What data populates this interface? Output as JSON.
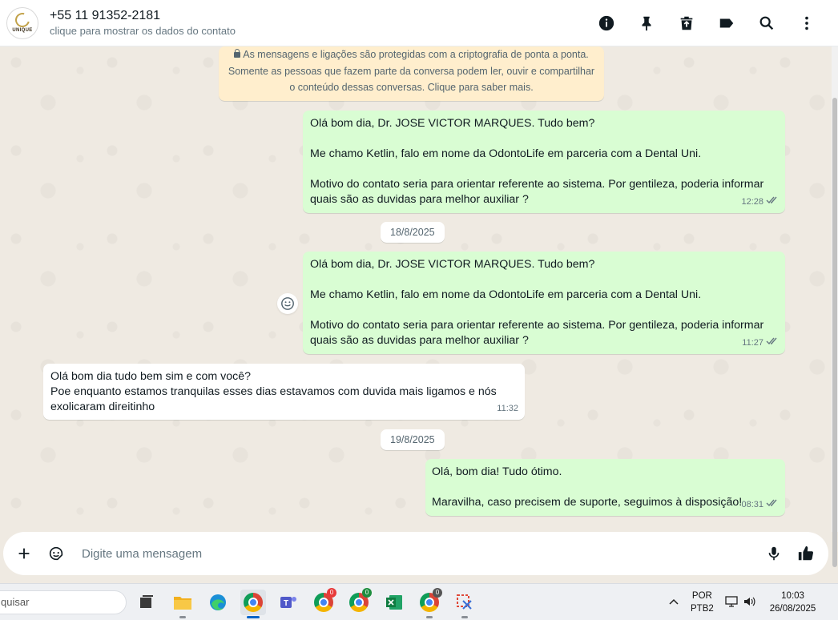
{
  "header": {
    "logo_text": "UNIQUE",
    "contact_name": "+55 11 91352-2181",
    "contact_subtitle": "clique para mostrar os dados do contato"
  },
  "encryption_notice": {
    "line1": "As mensagens e ligações são protegidas com a criptografia de ponta a ponta.",
    "line2": "Somente as pessoas que fazem parte da conversa podem ler, ouvir e compartilhar",
    "line3": "o conteúdo dessas conversas. Clique para saber mais."
  },
  "messages": [
    {
      "direction": "out",
      "lines": [
        "Olá bom dia, Dr. JOSE VICTOR MARQUES. Tudo bem?",
        "",
        "Me chamo Ketlin, falo em nome da OdontoLife em parceria com a Dental Uni.",
        "",
        "Motivo do contato seria para orientar referente ao sistema. Por gentileza, poderia informar",
        "quais são as duvidas para melhor auxiliar ?"
      ],
      "time": "12:28"
    },
    {
      "direction": "out",
      "lines": [
        "Olá bom dia, Dr. JOSE VICTOR MARQUES. Tudo bem?",
        "",
        "Me chamo Ketlin, falo em nome da OdontoLife em parceria com a Dental Uni.",
        "",
        "Motivo do contato seria para orientar referente ao sistema. Por gentileza, poderia informar",
        "quais são as duvidas para melhor auxiliar ?"
      ],
      "time": "11:27"
    },
    {
      "direction": "in",
      "lines": [
        "Olá bom dia tudo bem sim e com você?",
        "Poe enquanto estamos tranquilas esses dias estavamos com duvida mais ligamos e nós",
        "exolicaram direitinho"
      ],
      "time": "11:32"
    },
    {
      "direction": "out",
      "lines": [
        "Olá, bom dia! Tudo ótimo.",
        "",
        "Maravilha, caso precisem de suporte, seguimos à disposição!"
      ],
      "time": "08:31"
    }
  ],
  "date_separators": [
    "18/8/2025",
    "19/8/2025"
  ],
  "composer": {
    "placeholder": "Digite uma mensagem"
  },
  "taskbar": {
    "search_text": "quisar",
    "badges": [
      "0",
      "0",
      "0"
    ],
    "language": "POR",
    "keyboard": "PTB2",
    "time": "10:03",
    "date": "26/08/2025"
  },
  "colors": {
    "outgoing_bubble": "#d9fdd3",
    "incoming_bubble": "#ffffff",
    "chat_background": "#efeae2",
    "notice_background": "#ffeecd"
  }
}
